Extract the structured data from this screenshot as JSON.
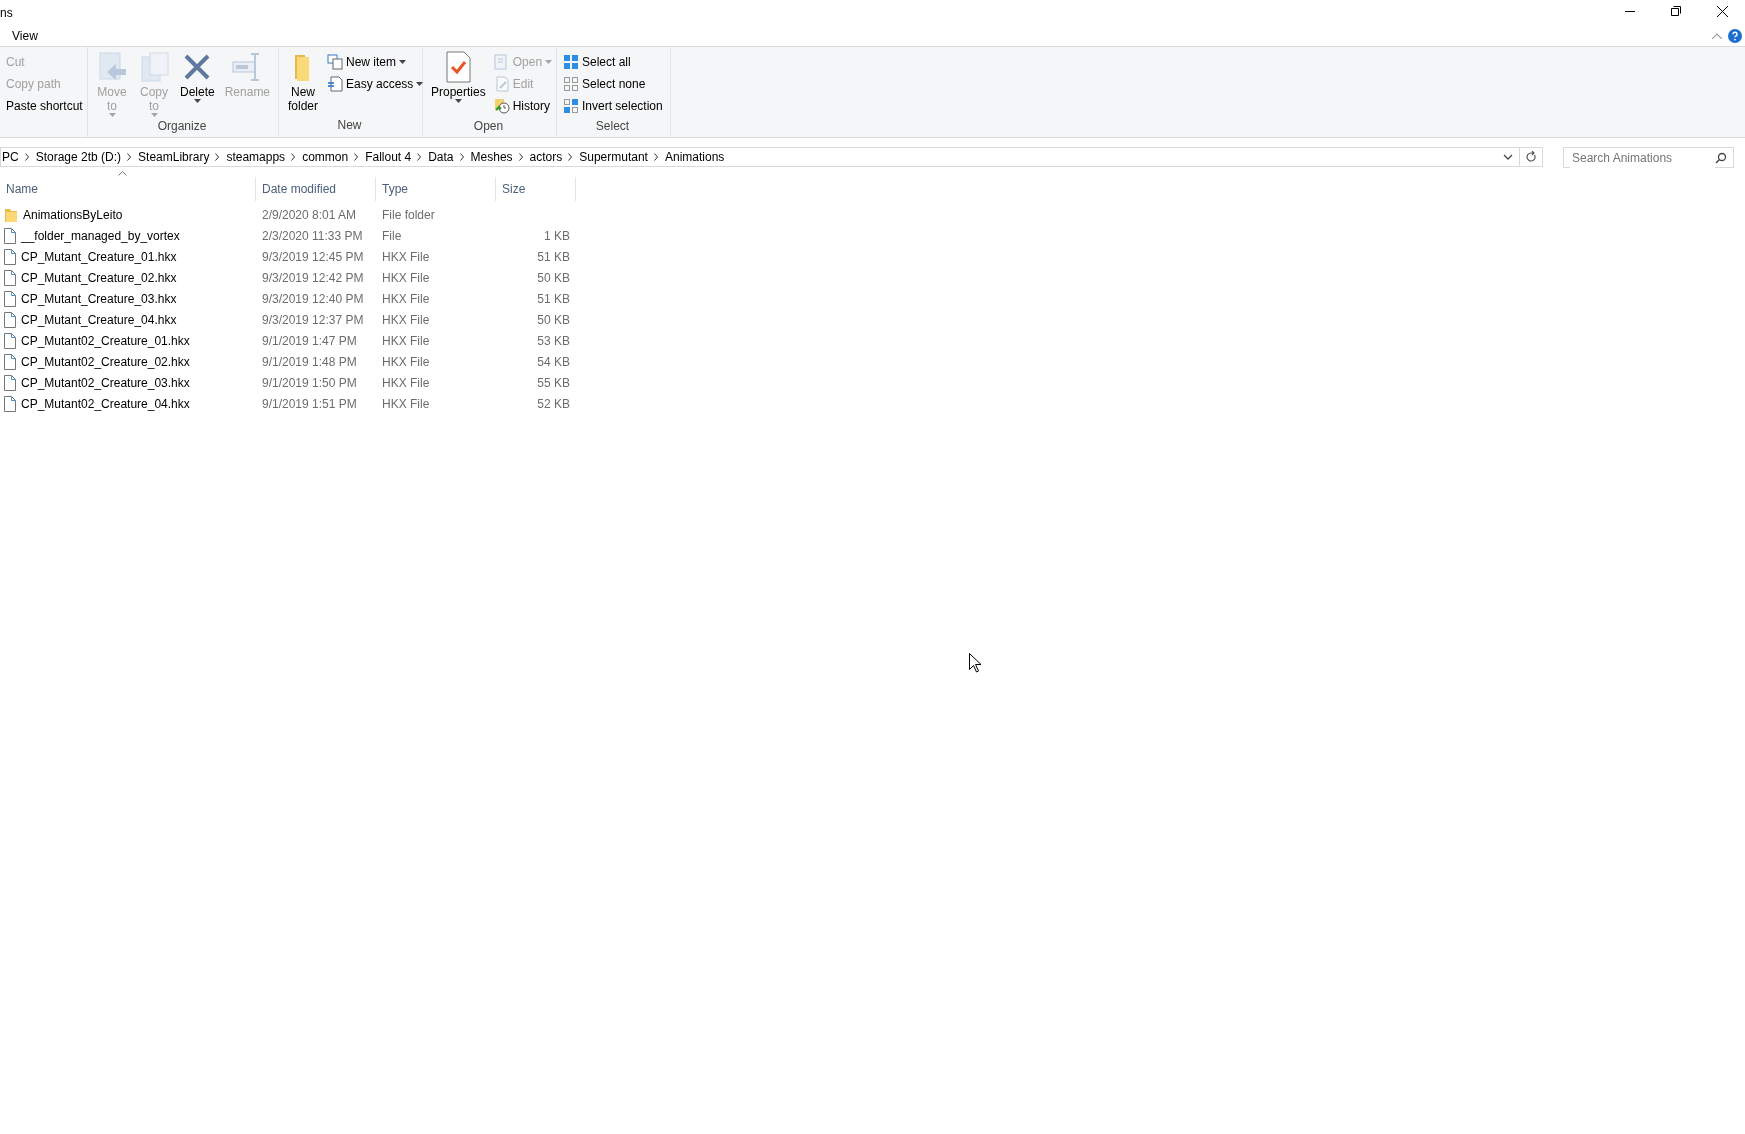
{
  "window": {
    "title": "ns"
  },
  "menu_tabs": [
    {
      "label": "View",
      "selected": false
    }
  ],
  "ribbon": [
    {
      "items": [
        {
          "kind": "small",
          "label": "Cut",
          "disabled": true,
          "dropdown": false
        },
        {
          "kind": "small",
          "label": "Copy path",
          "disabled": true,
          "dropdown": false
        },
        {
          "kind": "small",
          "label": "Paste shortcut",
          "disabled": false,
          "dropdown": false
        }
      ]
    },
    {
      "label": "Organize",
      "items": [
        {
          "kind": "large",
          "lines": [
            "Move",
            "to"
          ],
          "disabled": true,
          "dropdown": true
        },
        {
          "kind": "large",
          "lines": [
            "Copy",
            "to"
          ],
          "disabled": true,
          "dropdown": true
        },
        {
          "kind": "large",
          "lines": [
            "Delete"
          ],
          "disabled": false,
          "dropdown": true
        },
        {
          "kind": "large",
          "lines": [
            "Rename"
          ],
          "disabled": true,
          "dropdown": false
        }
      ]
    },
    {
      "label": "New",
      "items": [
        {
          "kind": "large",
          "lines": [
            "New",
            "folder"
          ],
          "disabled": false,
          "dropdown": false
        },
        {
          "kind": "small",
          "label": "New item",
          "disabled": false,
          "dropdown": true
        },
        {
          "kind": "small",
          "label": "Easy access",
          "disabled": false,
          "dropdown": true
        }
      ]
    },
    {
      "label": "Open",
      "items": [
        {
          "kind": "large",
          "lines": [
            "Properties"
          ],
          "disabled": false,
          "dropdown": true
        },
        {
          "kind": "small",
          "label": "Open",
          "disabled": true,
          "dropdown": true
        },
        {
          "kind": "small",
          "label": "Edit",
          "disabled": true,
          "dropdown": false
        },
        {
          "kind": "small",
          "label": "History",
          "disabled": false,
          "dropdown": false
        }
      ]
    },
    {
      "label": "Select",
      "items": [
        {
          "kind": "small",
          "label": "Select all",
          "disabled": false,
          "dropdown": false
        },
        {
          "kind": "small",
          "label": "Select none",
          "disabled": false,
          "dropdown": false
        },
        {
          "kind": "small",
          "label": "Invert selection",
          "disabled": false,
          "dropdown": false
        }
      ]
    }
  ],
  "address_bar": {
    "crumbs": [
      "PC",
      "Storage 2tb (D:)",
      "SteamLibrary",
      "steamapps",
      "common",
      "Fallout 4",
      "Data",
      "Meshes",
      "actors",
      "Supermutant",
      "Animations"
    ]
  },
  "search": {
    "placeholder": "Search Animations"
  },
  "columns": [
    {
      "label": "Name",
      "sorted": true
    },
    {
      "label": "Date modified",
      "sorted": false
    },
    {
      "label": "Type",
      "sorted": false
    },
    {
      "label": "Size",
      "sorted": false
    }
  ],
  "rows": [
    {
      "kind": "folder",
      "name": "AnimationsByLeito",
      "date": "2/9/2020 8:01 AM",
      "type": "File folder",
      "size": ""
    },
    {
      "kind": "file",
      "name": "__folder_managed_by_vortex",
      "date": "2/3/2020 11:33 PM",
      "type": "File",
      "size": "1 KB"
    },
    {
      "kind": "file",
      "name": "CP_Mutant_Creature_01.hkx",
      "date": "9/3/2019 12:45 PM",
      "type": "HKX File",
      "size": "51 KB"
    },
    {
      "kind": "file",
      "name": "CP_Mutant_Creature_02.hkx",
      "date": "9/3/2019 12:42 PM",
      "type": "HKX File",
      "size": "50 KB"
    },
    {
      "kind": "file",
      "name": "CP_Mutant_Creature_03.hkx",
      "date": "9/3/2019 12:40 PM",
      "type": "HKX File",
      "size": "51 KB"
    },
    {
      "kind": "file",
      "name": "CP_Mutant_Creature_04.hkx",
      "date": "9/3/2019 12:37 PM",
      "type": "HKX File",
      "size": "50 KB"
    },
    {
      "kind": "file",
      "name": "CP_Mutant02_Creature_01.hkx",
      "date": "9/1/2019 1:47 PM",
      "type": "HKX File",
      "size": "53 KB"
    },
    {
      "kind": "file",
      "name": "CP_Mutant02_Creature_02.hkx",
      "date": "9/1/2019 1:48 PM",
      "type": "HKX File",
      "size": "54 KB"
    },
    {
      "kind": "file",
      "name": "CP_Mutant02_Creature_03.hkx",
      "date": "9/1/2019 1:50 PM",
      "type": "HKX File",
      "size": "55 KB"
    },
    {
      "kind": "file",
      "name": "CP_Mutant02_Creature_04.hkx",
      "date": "9/1/2019 1:51 PM",
      "type": "HKX File",
      "size": "52 KB"
    }
  ]
}
